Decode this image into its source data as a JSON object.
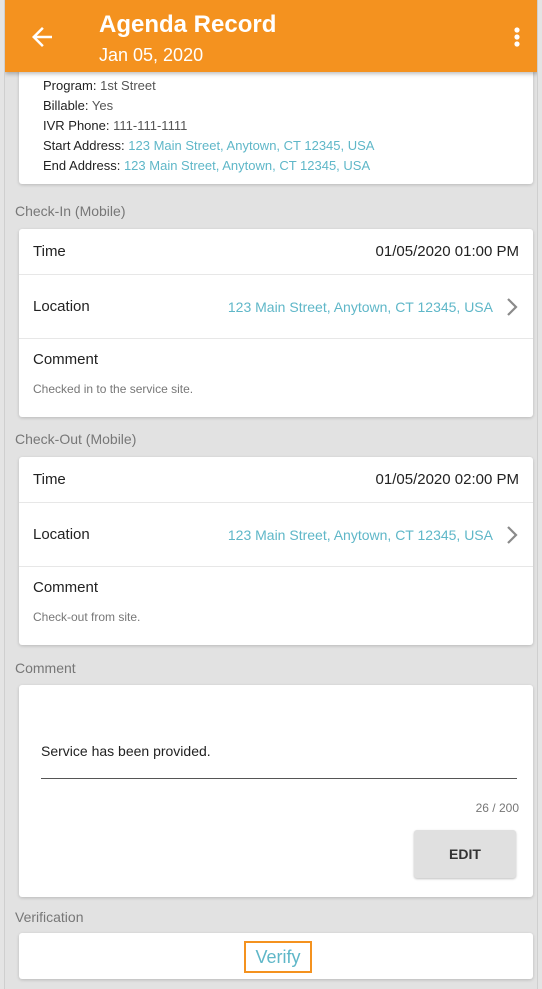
{
  "header": {
    "title": "Agenda Record",
    "date": "Jan 05, 2020",
    "back_icon": "arrow-left-icon",
    "menu_icon": "more-vert-icon",
    "color": "#f4921f"
  },
  "summary": {
    "program_label": "Program:",
    "program_value": "1st Street",
    "billable_label": "Billable:",
    "billable_value": "Yes",
    "ivr_label": "IVR Phone:",
    "ivr_value": "111-111-1111",
    "start_label": "Start Address:",
    "start_value": "123 Main Street, Anytown, CT 12345, USA",
    "end_label": "End Address:",
    "end_value": "123 Main Street, Anytown, CT 12345, USA"
  },
  "checkin": {
    "section_label": "Check-In (Mobile)",
    "time_label": "Time",
    "time_value": "01/05/2020  01:00 PM",
    "location_label": "Location",
    "location_value": "123 Main Street, Anytown, CT 12345, USA",
    "comment_label": "Comment",
    "comment_value": "Checked in to the service site."
  },
  "checkout": {
    "section_label": "Check-Out (Mobile)",
    "time_label": "Time",
    "time_value": "01/05/2020  02:00 PM",
    "location_label": "Location",
    "location_value": "123 Main Street, Anytown, CT 12345, USA",
    "comment_label": "Comment",
    "comment_value": "Check-out from site."
  },
  "comment": {
    "section_label": "Comment",
    "text": "Service has been provided.",
    "counter": "26 / 200",
    "edit_label": "EDIT"
  },
  "verification": {
    "section_label": "Verification",
    "verify_label": "Verify"
  },
  "colors": {
    "accent": "#f4921f",
    "link": "#5fb7c8"
  }
}
